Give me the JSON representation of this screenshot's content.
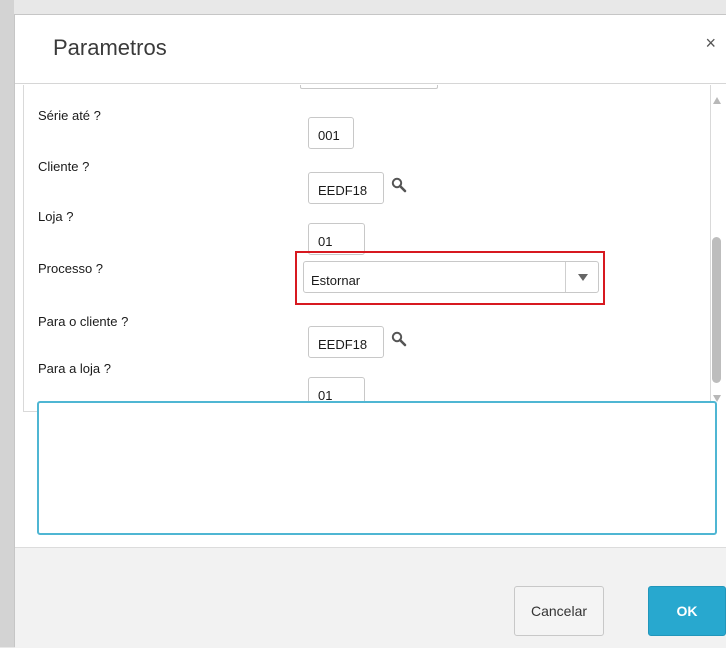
{
  "dialog": {
    "title": "Parametros",
    "close_label": "×"
  },
  "params": {
    "serie_ate": {
      "label": "Série até ?",
      "value": "001"
    },
    "cliente": {
      "label": "Cliente ?",
      "value": "EEDF18",
      "icon": "search-icon"
    },
    "loja": {
      "label": "Loja ?",
      "value": "01"
    },
    "processo": {
      "label": "Processo ?",
      "selected": "Estornar"
    },
    "para_cliente": {
      "label": "Para o cliente ?",
      "value": "EEDF18",
      "icon": "search-icon"
    },
    "para_loja": {
      "label": "Para a loja ?",
      "value": "01"
    }
  },
  "description_area": {
    "value": ""
  },
  "footer": {
    "cancel_label": "Cancelar",
    "ok_label": "OK"
  },
  "colors": {
    "accent": "#28a8cf",
    "highlight": "#d71920",
    "textarea_border": "#4fb6d3"
  }
}
